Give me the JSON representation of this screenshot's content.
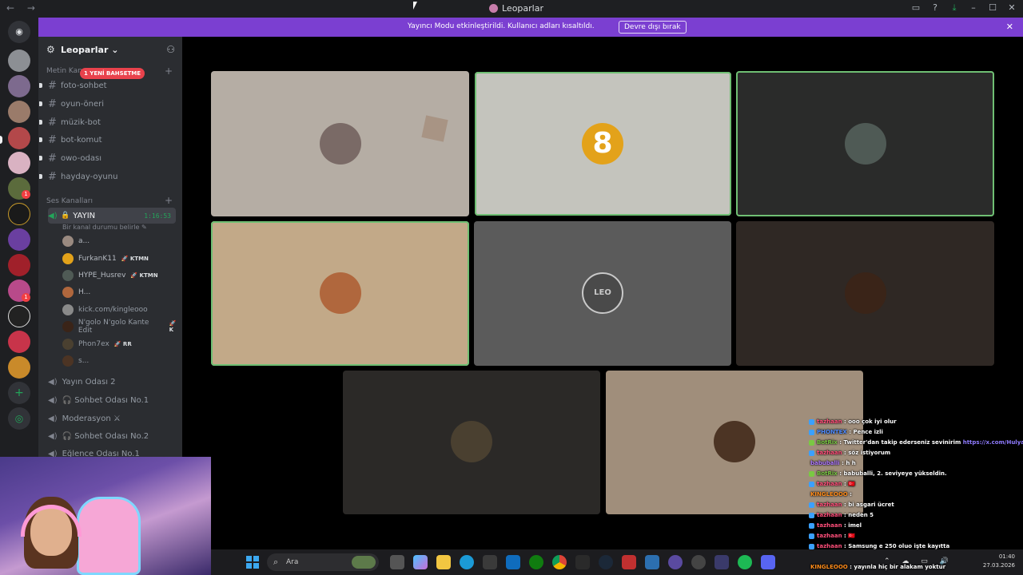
{
  "titlebar": {
    "nav": "← →",
    "title": "Leoparlar",
    "controls": [
      "▭",
      "?",
      "⤓",
      "–",
      "☐",
      "✕"
    ]
  },
  "banner": {
    "message": "Yayıncı Modu etkinleştirildi. Kullanıcı adları kısaltıldı.",
    "button": "Devre dışı bırak",
    "close": "✕"
  },
  "sidebar": {
    "server_name": "Leoparlar",
    "server_chevron": "⌄",
    "text_category": "Metin Kan",
    "mention_badge": "1 YENİ BAHSETME",
    "text_channels": [
      "foto-sohbet",
      "oyun-öneri",
      "müzik-bot",
      "bot-komut",
      "owo-odası",
      "hayday-oyunu"
    ],
    "voice_category": "Ses Kanalları",
    "active_voice": {
      "name": "YAYIN",
      "timer": "1:16:53",
      "status_hint": "Bir kanal durumu belirle ✎"
    },
    "voice_users": [
      {
        "name": "a...",
        "tag": ""
      },
      {
        "name": "FurkanK11",
        "tag": "🚀 KTMN"
      },
      {
        "name": "HYPE_Husrev",
        "tag": "🚀 KTMN"
      },
      {
        "name": "H...",
        "tag": ""
      },
      {
        "name": "kick.com/kingleooo",
        "tag": ""
      },
      {
        "name": "N'golo N'golo Kante Edit",
        "tag": "🚀 K"
      },
      {
        "name": "Phon7ex",
        "tag": "🚀 RR"
      },
      {
        "name": "s...",
        "tag": ""
      }
    ],
    "other_voice": [
      "Yayın Odası 2",
      "🎧 Sohbet Odası No.1",
      "Moderasyon ⚔",
      "🎧 Sohbet Odası No.2",
      "Eğlence Odası No.1"
    ]
  },
  "chat": [
    {
      "user": "tazhaan",
      "msg": ": ooo çok iyi olur",
      "color": "#ff4f7a"
    },
    {
      "user": "PHONTEX",
      "msg": ": Pence izli",
      "color": "#4f8bff"
    },
    {
      "user": "BotRix",
      "msg": ": Twitter'dan takip ederseniz sevinirim",
      "link": "https://x.com/Hulya_yarar",
      "color": "#7ac943"
    },
    {
      "user": "tazhaan",
      "msg": ": söz istiyorum",
      "color": "#ff4f7a"
    },
    {
      "user": "babuballi",
      "msg": ": h h",
      "color": "#b07bff"
    },
    {
      "user": "BotRix",
      "msg": ": babuballi, 2. seviyeye yükseldin.",
      "color": "#7ac943"
    },
    {
      "user": "tazhaan",
      "msg": ": 🇹🇷",
      "color": "#ff4f7a"
    },
    {
      "user": "KINGLEOOO",
      "msg": ":",
      "color": "#ff8c1a"
    },
    {
      "user": "tazhaan",
      "msg": ": bi asgari ücret",
      "color": "#ff4f7a"
    },
    {
      "user": "tazhaan",
      "msg": ": neden 5",
      "color": "#ff4f7a"
    },
    {
      "user": "tazhaan",
      "msg": ": imel",
      "color": "#ff4f7a"
    },
    {
      "user": "tazhaan",
      "msg": ": 🇹🇷",
      "color": "#ff4f7a"
    },
    {
      "user": "tazhaan",
      "msg": ": Samsung e 250 oluo işte kayıtta",
      "color": "#ff4f7a"
    },
    {
      "user": "tazhaan",
      "msg": ": 🇹🇷",
      "color": "#ff4f7a"
    },
    {
      "user": "KINGLEOOO",
      "msg": ": yayınla hiç bir alakam yoktur",
      "color": "#ff8c1a"
    }
  ],
  "taskbar": {
    "search_placeholder": "Ara",
    "time": "01:40",
    "date": "27.03.2026"
  },
  "tiles": [
    {
      "name": "tile-1",
      "bg": "#b5ada4",
      "avatar": "#7a6a66",
      "speaking": false
    },
    {
      "name": "tile-2",
      "bg": "#c4c4bd",
      "avatar": "#e3a21a",
      "label": "8",
      "speaking": true
    },
    {
      "name": "tile-3",
      "bg": "#2a2b2a",
      "avatar": "#4f5a55",
      "speaking": true
    },
    {
      "name": "tile-4",
      "bg": "#c2a988",
      "avatar": "#b0673d",
      "speaking": true
    },
    {
      "name": "tile-5",
      "bg": "#5b5b5b",
      "avatar": "#c9c9c9",
      "label": "LEO",
      "speaking": false
    },
    {
      "name": "tile-6",
      "bg": "#2f2824",
      "avatar": "#3a2418",
      "speaking": false
    },
    {
      "name": "tile-7",
      "bg": "#2b2927",
      "avatar": "#4a4030",
      "speaking": false
    },
    {
      "name": "tile-8",
      "bg": "#a08e7b",
      "avatar": "#4c3424",
      "speaking": false
    }
  ]
}
